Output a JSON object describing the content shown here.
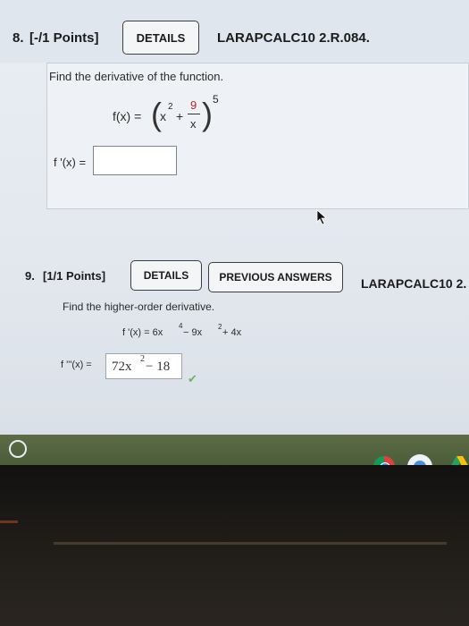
{
  "q8": {
    "number": "8.",
    "points": "[-/1 Points]",
    "details_label": "DETAILS",
    "code": "LARAPCALC10 2.R.084.",
    "prompt": "Find the derivative of the function.",
    "func_lhs": "f(x) =",
    "x_base": "x",
    "exp_2": "2",
    "plus": "+",
    "frac_num": "9",
    "frac_den": "x",
    "exp_5": "5",
    "answer_label": "f '(x) =",
    "answer_value": ""
  },
  "q9": {
    "number": "9.",
    "points": "[1/1 Points]",
    "details_label": "DETAILS",
    "previous_answers_label": "PREVIOUS ANSWERS",
    "code": "LARAPCALC10 2.",
    "prompt": "Find the higher-order derivative.",
    "given_lhs": "f '(x) = 6x",
    "exp_4": "4",
    "minus_9x": " − 9x",
    "exp_2a": "2",
    "plus_4x": " + 4x",
    "answer_label": "f '''(x) =",
    "answer_a": "72x",
    "answer_exp": "2",
    "answer_b": " − 18",
    "check_mark": "✔"
  },
  "taskbar": {
    "launcher": "launcher-icon",
    "apps": [
      "chrome-icon",
      "chrome-app-icon",
      "drive-icon"
    ]
  },
  "colors": {
    "accent_check": "#7daa6a",
    "taskbar": "#4f5e3c"
  }
}
